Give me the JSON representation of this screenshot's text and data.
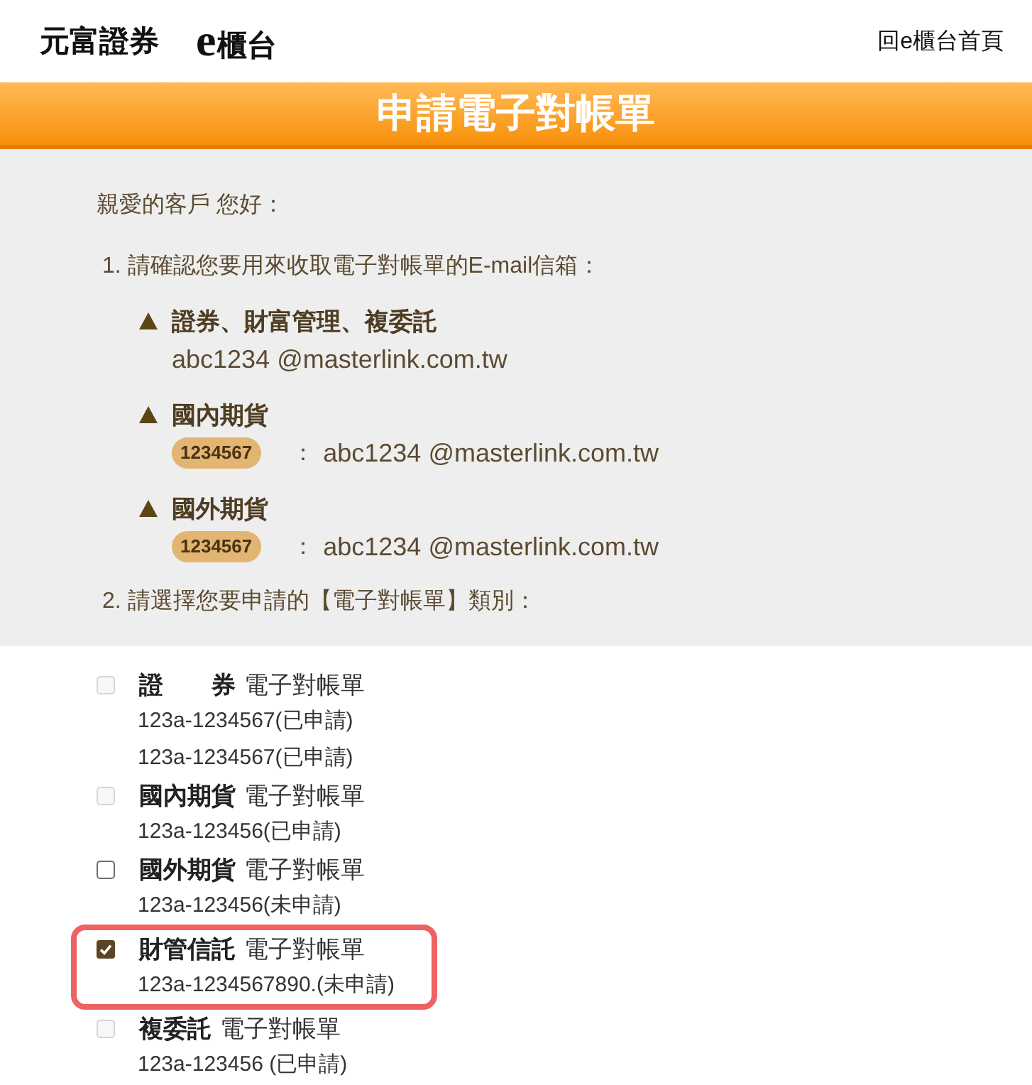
{
  "header": {
    "brand": "元富證券",
    "product_mark": "e",
    "product": "櫃台",
    "home_link": "回e櫃台首頁"
  },
  "banner": {
    "title": "申請電子對帳單"
  },
  "intro": {
    "greeting": "親愛的客戶 您好：",
    "step_1": "1. 請確認您要用來收取電子對帳單的E-mail信箱：",
    "email_groups": [
      {
        "title": "證券、財富管理、複委託",
        "email": "abc1234 @masterlink.com.tw"
      },
      {
        "title": "國內期貨",
        "account": "1234567",
        "separator": "：",
        "email": "abc1234 @masterlink.com.tw"
      },
      {
        "title": "國外期貨",
        "account": "1234567",
        "separator": "：",
        "email": "abc1234 @masterlink.com.tw"
      }
    ],
    "step_2": "2. 請選擇您要申請的【電子對帳單】類別："
  },
  "statement_options": [
    {
      "name": "證　　券",
      "label": "電子對帳單",
      "checked": false,
      "disabled": true,
      "highlighted": false,
      "accounts": [
        "123a-1234567(已申請)",
        "123a-1234567(已申請)"
      ]
    },
    {
      "name": "國內期貨",
      "label": "電子對帳單",
      "checked": false,
      "disabled": true,
      "highlighted": false,
      "accounts": [
        "123a-123456(已申請)"
      ]
    },
    {
      "name": "國外期貨",
      "label": "電子對帳單",
      "checked": false,
      "disabled": false,
      "highlighted": false,
      "accounts": [
        "123a-123456(未申請)"
      ]
    },
    {
      "name": "財管信託",
      "label": "電子對帳單",
      "checked": true,
      "disabled": false,
      "highlighted": true,
      "accounts": [
        "123a-1234567890.(未申請)"
      ]
    },
    {
      "name": "複委託",
      "label": "電子對帳單",
      "checked": false,
      "disabled": true,
      "highlighted": false,
      "accounts": [
        "123a-123456 (已申請)"
      ]
    }
  ]
}
